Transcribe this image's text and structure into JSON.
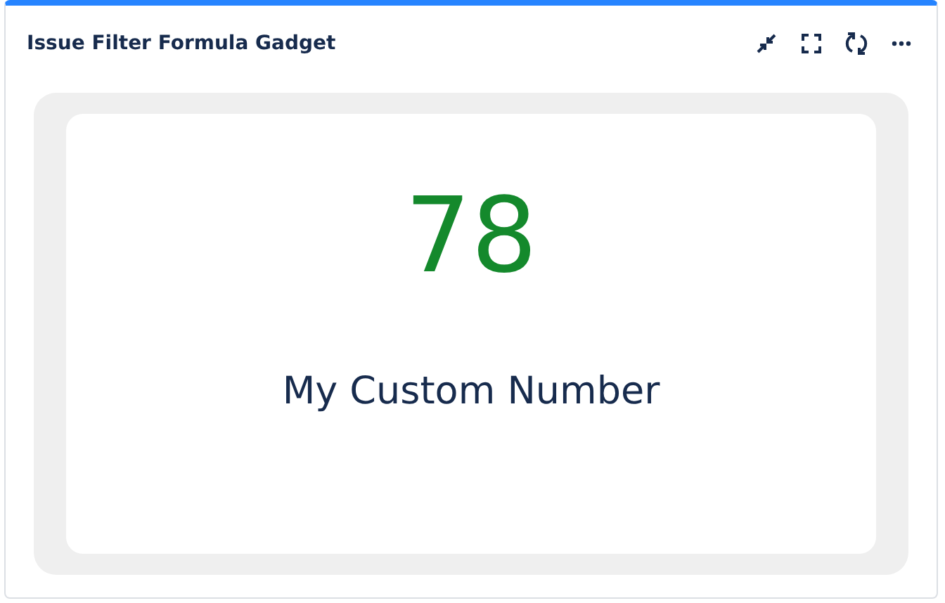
{
  "gadget": {
    "title": "Issue Filter Formula Gadget"
  },
  "result": {
    "value": "78",
    "label": "My Custom Number"
  }
}
